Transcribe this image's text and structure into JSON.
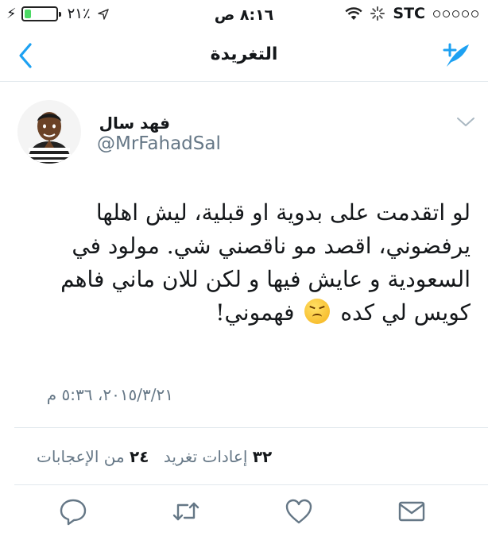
{
  "status_bar": {
    "battery_percent": "٢١٪",
    "time": "٨:١٦ ص",
    "carrier": "STC",
    "battery_level": 0.21
  },
  "nav": {
    "title": "التغريدة",
    "back_icon": "chevron-left-icon",
    "compose_icon": "compose-feather-icon"
  },
  "tweet": {
    "name": "فهد سال",
    "handle": "@MrFahadSal",
    "text_before_emoji": "لو اتقدمت على بدوية او قبلية، ليش اهلها يرفضوني، اقصد مو ناقصني شي. مولود في السعودية و عايش فيها و لكن للان ماني فاهم كويس لي كده",
    "text_after_emoji": "فهموني!",
    "timestamp": "٢٠١٥/٣/٢١، ٥:٣٦ م",
    "likes_count": "٢٤",
    "likes_label": "من الإعجابات",
    "retweets_count": "٣٢",
    "retweets_label": "إعادات تغريد"
  },
  "colors": {
    "accent": "#1da1f2",
    "muted": "#657786",
    "divider": "#e1e8ed",
    "action_icon": "#657786"
  }
}
